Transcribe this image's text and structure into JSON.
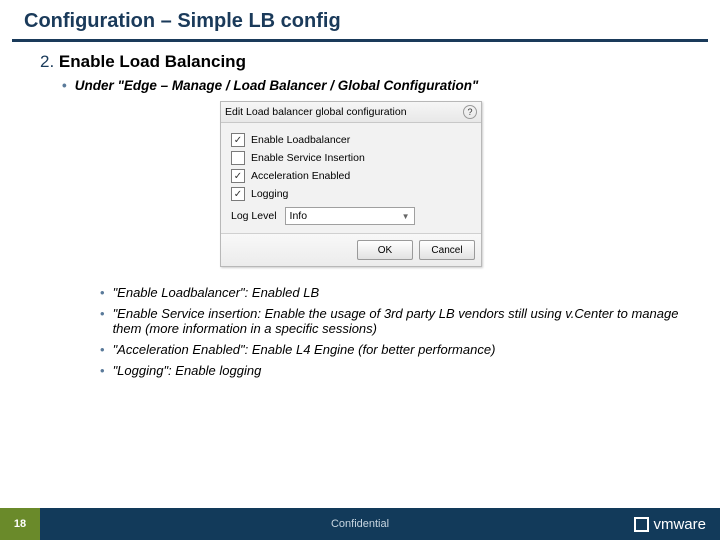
{
  "title": "Configuration – Simple LB config",
  "step_number": "2.",
  "step_title": "Enable Load Balancing",
  "path_bullet": "Under \"Edge – Manage / Load Balancer /  Global Configuration\"",
  "dialog": {
    "title": "Edit Load balancer global configuration",
    "options": [
      {
        "label": "Enable Loadbalancer",
        "checked": true
      },
      {
        "label": "Enable Service Insertion",
        "checked": false
      },
      {
        "label": "Acceleration Enabled",
        "checked": true
      },
      {
        "label": "Logging",
        "checked": true
      }
    ],
    "log_label": "Log Level",
    "log_value": "Info",
    "ok": "OK",
    "cancel": "Cancel"
  },
  "subs": [
    "\"Enable Loadbalancer\": Enabled LB",
    "\"Enable Service insertion: Enable the usage of 3rd party LB vendors still using v.Center to manage them (more information in a specific sessions)",
    "\"Acceleration Enabled\": Enable L4 Engine (for better performance)",
    "\"Logging\": Enable logging"
  ],
  "footer": {
    "page": "18",
    "confidential": "Confidential",
    "brand": "vmware"
  }
}
